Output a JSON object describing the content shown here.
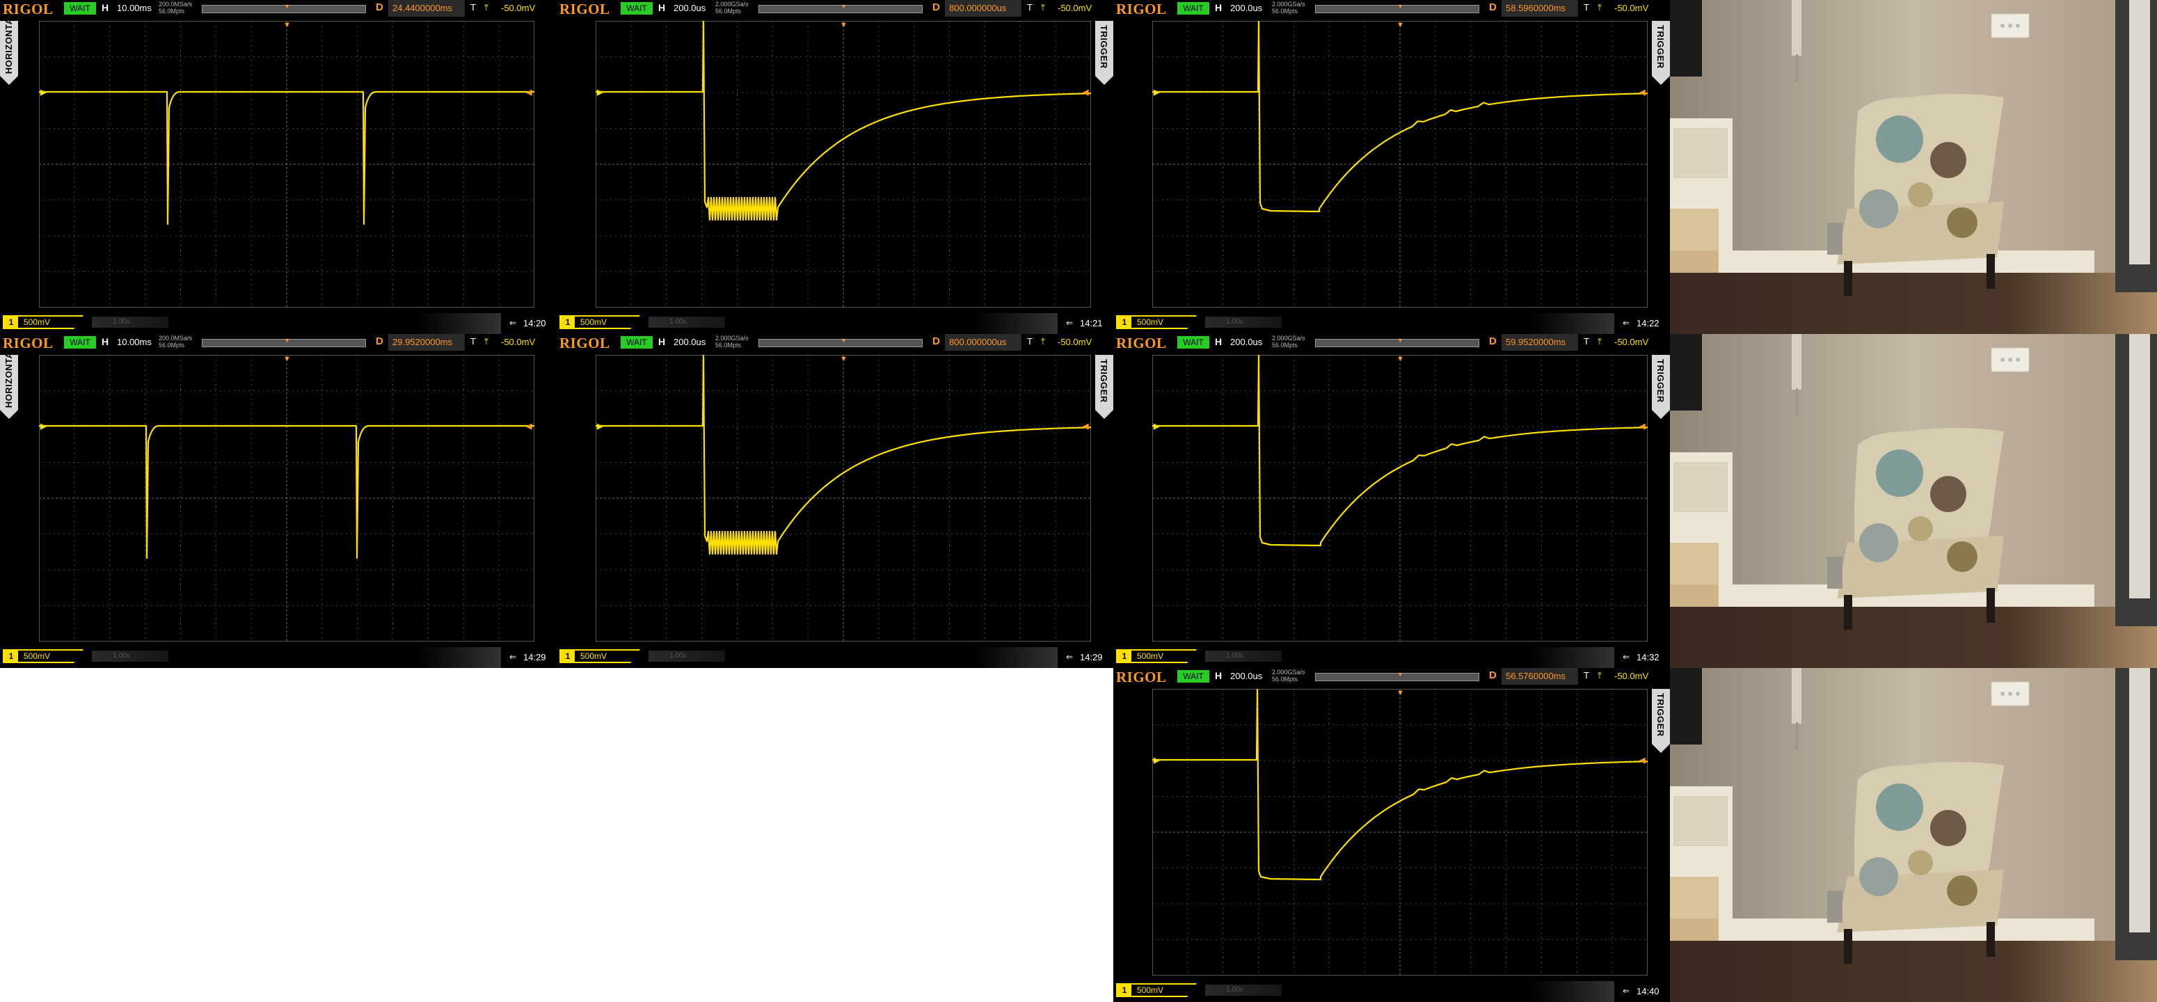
{
  "common": {
    "brand": "RIGOL",
    "state": "WAIT",
    "h_label": "H",
    "d_label": "D",
    "t_label": "T",
    "trig_symbol": "⤒",
    "trig_level": "-50.0mV",
    "side_horizontal": "HORIZONTAL",
    "side_trigger": "TRIGGER",
    "ch_num": "1",
    "ch_scale": "500mV",
    "ghost": "1.00x",
    "usb": "⇐"
  },
  "colors": {
    "trace": "#ffe000",
    "accent": "#ff9a1f",
    "grid": "#5a5a5a",
    "wait": "#27cc27"
  },
  "screens": [
    {
      "timebase": "10.00ms",
      "srate": "200.0MSa/s\n56.0Mpts",
      "delay": "24.4400000ms",
      "time": "14:20",
      "side": "horizontal"
    },
    {
      "timebase": "200.0us",
      "srate": "2.000GSa/s\n56.0Mpts",
      "delay": "800.000000us",
      "time": "14:21",
      "side": "trigger"
    },
    {
      "timebase": "200.0us",
      "srate": "2.000GSa/s\n56.0Mpts",
      "delay": "58.5960000ms",
      "time": "14:22",
      "side": "trigger"
    },
    {
      "timebase": "10.00ms",
      "srate": "200.0MSa/s\n56.0Mpts",
      "delay": "29.9520000ms",
      "time": "14:29",
      "side": "horizontal"
    },
    {
      "timebase": "200.0us",
      "srate": "2.000GSa/s\n56.0Mpts",
      "delay": "800.000000us",
      "time": "14:29",
      "side": "trigger"
    },
    {
      "timebase": "200.0us",
      "srate": "2.000GSa/s\n56.0Mpts",
      "delay": "59.9520000ms",
      "time": "14:32",
      "side": "trigger"
    },
    {
      "timebase": "200.0us",
      "srate": "2.000GSa/s\n56.0Mpts",
      "delay": "56.5760000ms",
      "time": "14:40",
      "side": "trigger"
    }
  ]
}
